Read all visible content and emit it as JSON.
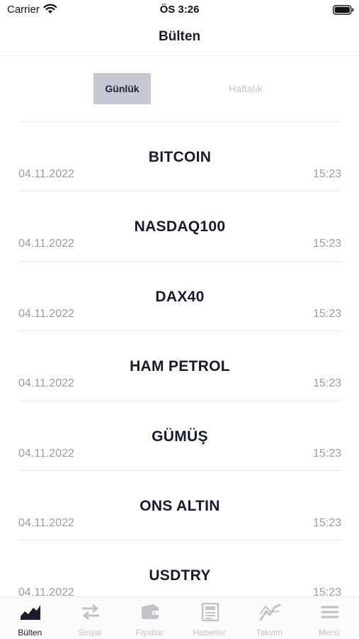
{
  "status": {
    "carrier": "Carrier",
    "time": "ÖS 3:26"
  },
  "nav": {
    "title": "Bülten"
  },
  "segments": {
    "daily": "Günlük",
    "weekly": "Haftalık",
    "selected": "daily"
  },
  "items": [
    {
      "title": "BITCOIN",
      "date": "04.11.2022",
      "time": "15:23"
    },
    {
      "title": "NASDAQ100",
      "date": "04.11.2022",
      "time": "15:23"
    },
    {
      "title": "DAX40",
      "date": "04.11.2022",
      "time": "15:23"
    },
    {
      "title": "HAM PETROL",
      "date": "04.11.2022",
      "time": "15:23"
    },
    {
      "title": "GÜMÜŞ",
      "date": "04.11.2022",
      "time": "15:23"
    },
    {
      "title": "ONS ALTIN",
      "date": "04.11.2022",
      "time": "15:23"
    },
    {
      "title": "USDTRY",
      "date": "04.11.2022",
      "time": "15:23"
    }
  ],
  "tabs": [
    {
      "label": "Bülten",
      "icon": "area-chart-icon",
      "active": true
    },
    {
      "label": "Sinyal",
      "icon": "swap-arrows-icon",
      "active": false
    },
    {
      "label": "Fiyatlar",
      "icon": "wallet-icon",
      "active": false
    },
    {
      "label": "Haberler",
      "icon": "newspaper-icon",
      "active": false
    },
    {
      "label": "Takvim",
      "icon": "line-chart-icon",
      "active": false
    },
    {
      "label": "Menü",
      "icon": "hamburger-menu-icon",
      "active": false
    }
  ],
  "colors": {
    "active": "#1a1c2b",
    "inactive": "#c2c3c8",
    "segment_selected_bg": "#c6c9d3"
  }
}
